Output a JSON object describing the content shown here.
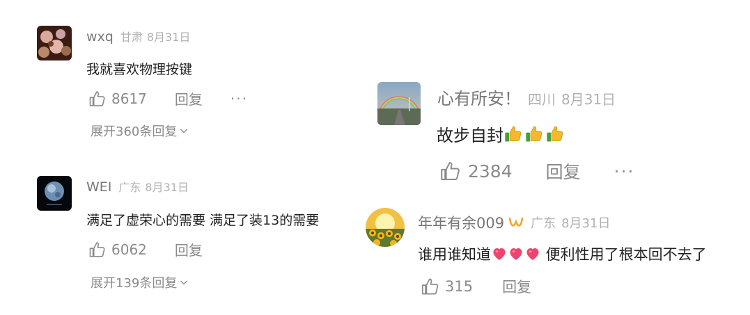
{
  "comments": [
    {
      "username": "wxq",
      "location": "甘肃",
      "date": "8月31日",
      "text": "我就喜欢物理按键",
      "likes": "8617",
      "reply_label": "回复",
      "more_label": "···",
      "expand_label": "展开360条回复"
    },
    {
      "username": "WEI",
      "location": "广东",
      "date": "8月31日",
      "text": "满足了虚荣心的需要 满足了装13的需要",
      "likes": "6062",
      "reply_label": "回复",
      "expand_label": "展开139条回复"
    },
    {
      "username": "心有所安！",
      "location": "四川",
      "date": "8月31日",
      "text": "故步自封",
      "emoji": "thumbs-up-emoji",
      "emoji_count": 3,
      "likes": "2384",
      "reply_label": "回复",
      "more_label": "···"
    },
    {
      "username": "年年有余009",
      "badge": "creator-badge-icon",
      "location": "广东",
      "date": "8月31日",
      "text_before": "谁用谁知道",
      "emoji": "heart-emoji",
      "emoji_count": 3,
      "text_after": " 便利性用了根本回不去了",
      "likes": "315",
      "reply_label": "回复"
    }
  ],
  "colors": {
    "username": "#777777",
    "meta": "#b0b0b0",
    "action": "#8a8a8a",
    "text": "#222222",
    "badge": "#f5a623"
  }
}
